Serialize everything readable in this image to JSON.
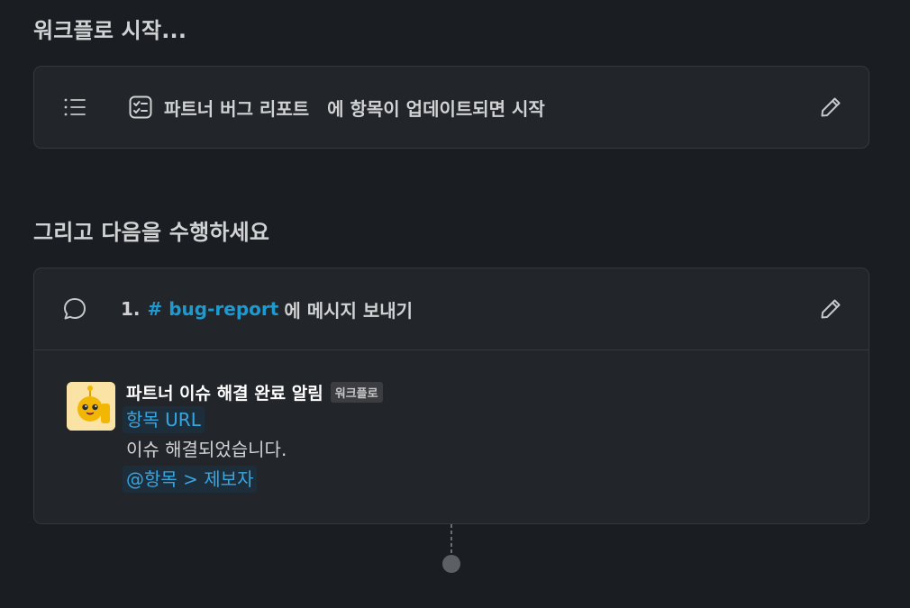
{
  "trigger_section": {
    "title": "워크플로 시작...",
    "list_name": "파트너 버그 리포트",
    "condition_text": "에 항목이 업데이트되면 시작"
  },
  "action_section": {
    "title": "그리고 다음을 수행하세요",
    "step_number": "1.",
    "channel": "# bug-report",
    "action_text": "에 메시지 보내기"
  },
  "message": {
    "sender": "파트너 이슈 해결 완료 알림",
    "badge": "워크플로",
    "link_token": "항목 URL",
    "body_text": "이슈 해결되었습니다.",
    "mention_token": "@항목 > 제보자"
  },
  "icons": {
    "trigger": "list-icon",
    "list_item": "checklist-icon",
    "action": "message-bubble-icon",
    "edit": "pencil-icon"
  },
  "colors": {
    "background": "#1a1d21",
    "card": "#222529",
    "border": "#35373b",
    "link": "#1d9bd1",
    "text": "#d1d2d3"
  }
}
